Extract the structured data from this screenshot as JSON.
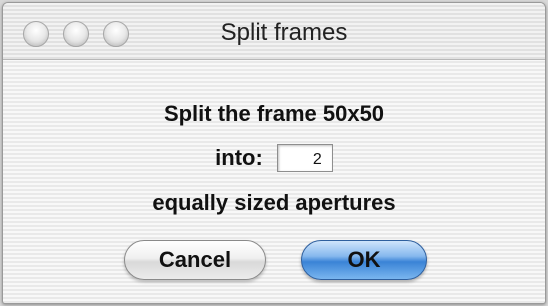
{
  "window": {
    "title": "Split frames"
  },
  "dialog": {
    "line1": "Split the frame 50x50",
    "into_label": "into:",
    "into_value": "2",
    "line3": "equally sized apertures"
  },
  "buttons": {
    "cancel": "Cancel",
    "ok": "OK"
  },
  "colors": {
    "ok_button": "#3a83d6",
    "window_bg": "#f4f4f4"
  }
}
